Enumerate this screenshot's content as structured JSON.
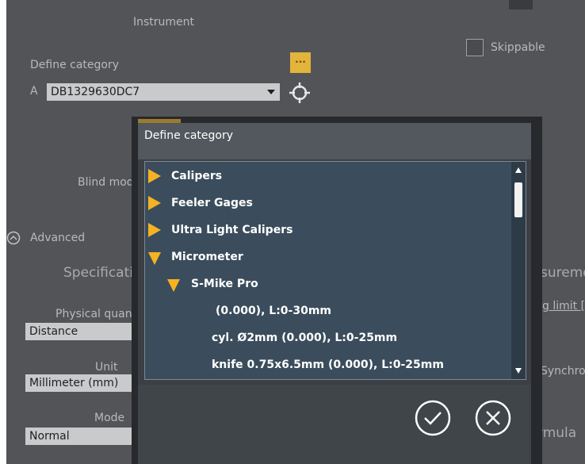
{
  "background": {
    "instrument_label": "Instrument",
    "define_category_label": "Define category",
    "channel_letter": "A",
    "device_select_value": "DB1329630DC7",
    "browse_button_label": "...",
    "skippable_label": "Skippable",
    "blind_mode_label": "Blind mod",
    "advanced_label": "Advanced",
    "specification_label": "Specificati",
    "physical_quantity_label": "Physical quan",
    "physical_quantity_value": "Distance",
    "unit_label": "Unit",
    "unit_value": "Millimeter (mm)",
    "mode_label": "Mode",
    "mode_value": "Normal",
    "measurement_label": "suremen",
    "limit_label": "g limit [",
    "synchro_label": "Synchro",
    "formula_label": "rmula"
  },
  "dialog": {
    "title": "Define category",
    "tree": [
      {
        "label": "Calipers",
        "expanded": false,
        "level": 0
      },
      {
        "label": "Feeler Gages",
        "expanded": false,
        "level": 0
      },
      {
        "label": "Ultra Light Calipers",
        "expanded": false,
        "level": 0
      },
      {
        "label": "Micrometer",
        "expanded": true,
        "level": 0
      },
      {
        "label": "S-Mike Pro",
        "expanded": true,
        "level": 1
      },
      {
        "label": "(0.000), L:0-30mm",
        "level": 2
      },
      {
        "label": "cyl. Ø2mm (0.000), L:0-25mm",
        "level": 2
      },
      {
        "label": "knife 0.75x6.5mm (0.000), L:0-25mm",
        "level": 2
      }
    ]
  },
  "colors": {
    "accent": "#f5b223",
    "tree_bg": "#3b4d5c",
    "dialog_bg": "#3c3f43",
    "page_bg": "#535457"
  }
}
